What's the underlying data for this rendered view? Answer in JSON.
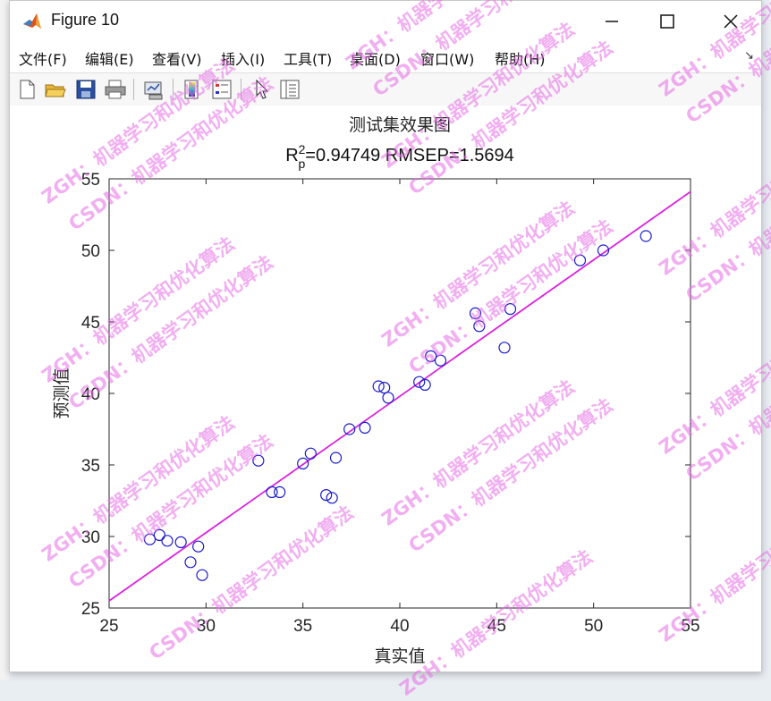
{
  "window": {
    "title": "Figure 10",
    "minimize_icon": "minimize-icon",
    "maximize_icon": "maximize-icon",
    "close_icon": "close-icon"
  },
  "menu": {
    "items": [
      "文件(F)",
      "编辑(E)",
      "查看(V)",
      "插入(I)",
      "工具(T)",
      "桌面(D)",
      "窗口(W)",
      "帮助(H)"
    ],
    "dock_arrow": "↘"
  },
  "toolbar": {
    "icons": [
      "new-figure-icon",
      "open-file-icon",
      "save-icon",
      "print-icon",
      "link-plot-icon",
      "insert-colorbar-icon",
      "insert-legend-icon",
      "edit-plot-icon",
      "property-inspector-icon"
    ]
  },
  "colors": {
    "marker": "#1a1acc",
    "fit_line": "#dd22dd",
    "watermark": "#e66ee6"
  },
  "watermark": {
    "line1": "ZGH：机器学习和优化算法",
    "line2": "CSDN：机器学习和优化算法"
  },
  "chart_data": {
    "type": "scatter",
    "title": "测试集效果图",
    "subtitle_r2_base": "R",
    "subtitle_r2_sup": "2",
    "subtitle_r2_sub": "p",
    "subtitle_rest": "=0.94749  RMSEP=1.5694",
    "xlabel": "真实值",
    "ylabel": "预测值",
    "xlim": [
      25,
      55
    ],
    "ylim": [
      25,
      55
    ],
    "xticks": [
      25,
      30,
      35,
      40,
      45,
      50,
      55
    ],
    "yticks": [
      25,
      30,
      35,
      40,
      45,
      50,
      55
    ],
    "grid": false,
    "marker": "circle-open",
    "points": [
      [
        27.1,
        29.8
      ],
      [
        27.6,
        30.1
      ],
      [
        28.0,
        29.7
      ],
      [
        28.7,
        29.6
      ],
      [
        29.2,
        28.2
      ],
      [
        29.6,
        29.3
      ],
      [
        29.8,
        27.3
      ],
      [
        32.7,
        35.3
      ],
      [
        33.4,
        33.1
      ],
      [
        33.8,
        33.1
      ],
      [
        35.0,
        35.1
      ],
      [
        35.4,
        35.8
      ],
      [
        36.2,
        32.9
      ],
      [
        36.5,
        32.7
      ],
      [
        36.7,
        35.5
      ],
      [
        37.4,
        37.5
      ],
      [
        38.2,
        37.6
      ],
      [
        38.9,
        40.5
      ],
      [
        39.2,
        40.4
      ],
      [
        39.4,
        39.7
      ],
      [
        41.0,
        40.8
      ],
      [
        41.3,
        40.6
      ],
      [
        41.6,
        42.6
      ],
      [
        42.1,
        42.3
      ],
      [
        43.9,
        45.6
      ],
      [
        44.1,
        44.7
      ],
      [
        45.4,
        43.2
      ],
      [
        45.7,
        45.9
      ],
      [
        49.3,
        49.3
      ],
      [
        50.5,
        50.0
      ],
      [
        52.7,
        51.0
      ]
    ],
    "fit_line": {
      "x": [
        25,
        55
      ],
      "y": [
        25.5,
        54.1
      ]
    }
  }
}
